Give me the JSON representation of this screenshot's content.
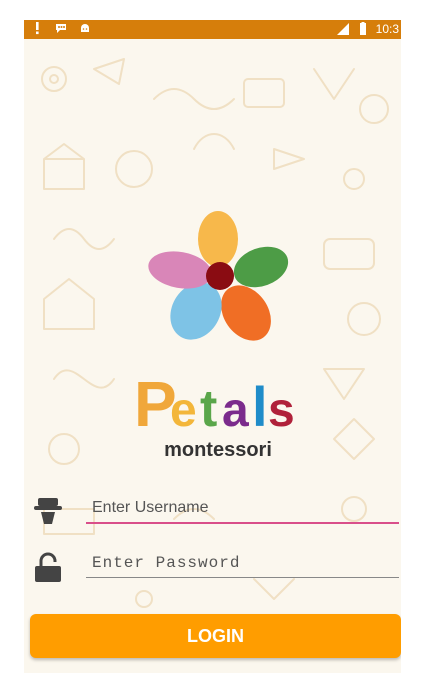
{
  "status_bar": {
    "time": "10:3",
    "left_icons": [
      "alert-icon",
      "chat-icon",
      "android-icon"
    ],
    "right_icons": [
      "signal-icon",
      "battery-icon"
    ],
    "color": "#d67e0b"
  },
  "logo": {
    "wordmark_letters": [
      "P",
      "e",
      "t",
      "a",
      "l",
      "s"
    ],
    "wordmark_colors": [
      "#f0a73a",
      "#f3b63a",
      "#5aa64a",
      "#7b2b8c",
      "#1f8cc9",
      "#b0213a"
    ],
    "tagline": "montessori",
    "petal_colors": [
      "#f7b84b",
      "#4d9c46",
      "#f06e25",
      "#7ec3e6",
      "#d986b8"
    ],
    "center_color": "#8a0c12"
  },
  "form": {
    "username": {
      "placeholder": "Enter Username",
      "value": ""
    },
    "password": {
      "placeholder": "Enter Password",
      "value": ""
    },
    "login_label": "LOGIN",
    "accent_color": "#ff9d00",
    "underline_color": "#d94f8a"
  },
  "icons": {
    "username_field": "user-icon",
    "password_field": "lock-icon"
  }
}
